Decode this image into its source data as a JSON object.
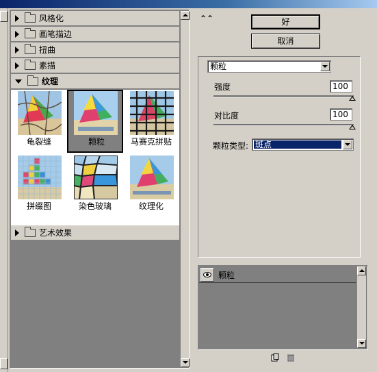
{
  "colors": {
    "panel": "#d4d0c8",
    "dark": "#808080",
    "selection": "#0a246a",
    "titlebar": "#3a6ea5"
  },
  "categories": [
    {
      "label": "风格化",
      "open": false
    },
    {
      "label": "画笔描边",
      "open": false
    },
    {
      "label": "扭曲",
      "open": false
    },
    {
      "label": "素描",
      "open": false
    },
    {
      "label": "纹理",
      "open": true
    },
    {
      "label": "艺术效果",
      "open": false
    }
  ],
  "thumbnails": [
    {
      "label": "龟裂缝",
      "selected": false
    },
    {
      "label": "颗粒",
      "selected": true
    },
    {
      "label": "马赛克拼贴",
      "selected": false
    },
    {
      "label": "拼缀图",
      "selected": false
    },
    {
      "label": "染色玻璃",
      "selected": false
    },
    {
      "label": "纹理化",
      "selected": false
    }
  ],
  "buttons": {
    "ok": "好",
    "cancel": "取消",
    "collapse": "⌃⌃"
  },
  "filter_select": {
    "value": "颗粒"
  },
  "params": {
    "intensity": {
      "label": "强度",
      "value": "100"
    },
    "contrast": {
      "label": "对比度",
      "value": "100"
    },
    "grain_type": {
      "label": "颗粒类型:",
      "value": "斑点"
    }
  },
  "layers": [
    {
      "name": "颗粒",
      "visible": true
    }
  ],
  "icons": {
    "new_layer": "new-effect-layer-icon",
    "delete_layer": "trash-icon"
  }
}
